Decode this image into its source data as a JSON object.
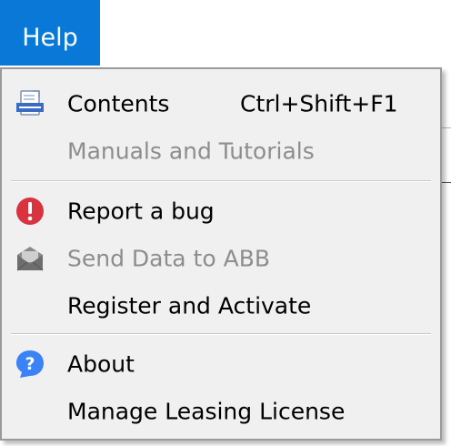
{
  "menubar": {
    "help_label": "Help"
  },
  "menu": {
    "items": [
      {
        "label": "Contents",
        "shortcut": "Ctrl+Shift+F1",
        "icon": "contents-doc-icon",
        "enabled": true
      },
      {
        "label": "Manuals and Tutorials",
        "enabled": false
      },
      {
        "label": "Report a bug",
        "icon": "error-icon",
        "enabled": true
      },
      {
        "label": "Send Data to ABB",
        "icon": "envelope-icon",
        "enabled": false
      },
      {
        "label": "Register and Activate",
        "enabled": true
      },
      {
        "label": "About",
        "icon": "help-icon",
        "enabled": true
      },
      {
        "label": "Manage Leasing License",
        "enabled": true
      }
    ]
  },
  "colors": {
    "menubar_active": "#0a78d7",
    "menu_background": "#f0f0f0",
    "disabled_text": "#8d8d8d",
    "error_icon": "#d9333f",
    "help_icon": "#3b82f6"
  }
}
